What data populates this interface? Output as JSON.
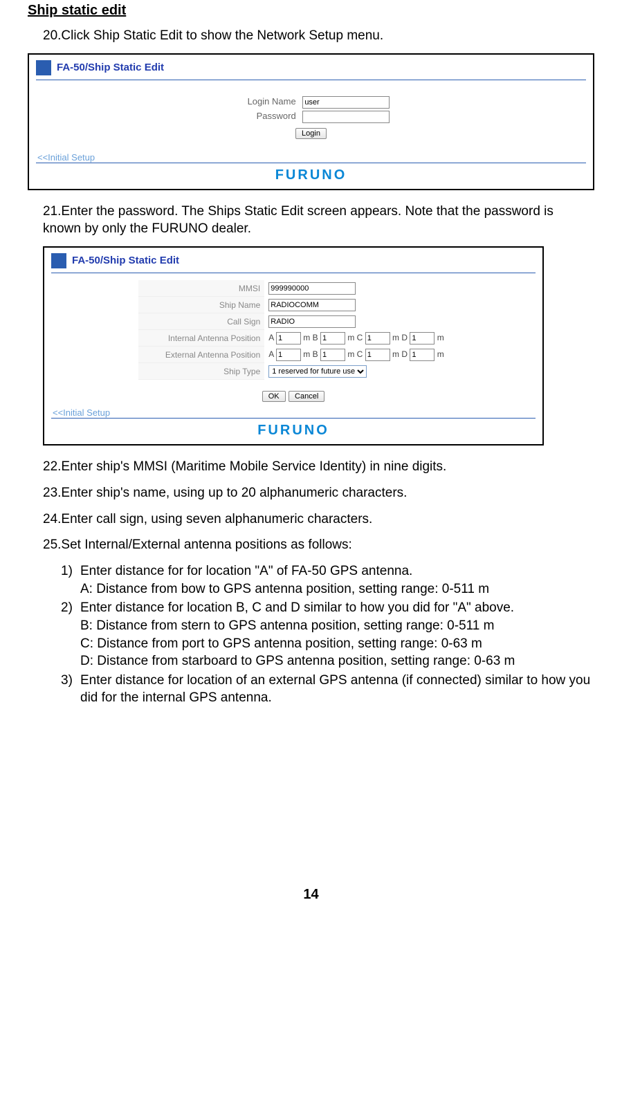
{
  "section_title": "Ship static edit",
  "step20": "20.Click Ship Static Edit to show the Network Setup menu.",
  "panel1": {
    "title": "FA-50/Ship Static Edit",
    "login_name_label": "Login Name",
    "login_name_value": "user",
    "password_label": "Password",
    "password_value": "",
    "login_btn": "Login",
    "back_link": "<<Initial Setup",
    "logo": "FURUNO"
  },
  "step21": "21.Enter the password. The Ships Static Edit screen appears. Note that the password is known by only the FURUNO dealer.",
  "panel2": {
    "title": "FA-50/Ship Static Edit",
    "fields": {
      "mmsi_label": "MMSI",
      "mmsi_value": "999990000",
      "shipname_label": "Ship Name",
      "shipname_value": "RADIOCOMM",
      "callsign_label": "Call Sign",
      "callsign_value": "RADIO",
      "intpos_label": "Internal Antenna Position",
      "extpos_label": "External Antenna Position",
      "shiptype_label": "Ship Type",
      "shiptype_value": "1 reserved for future use",
      "pos_a": "1",
      "pos_b": "1",
      "pos_c": "1",
      "pos_d": "1",
      "A": "A",
      "B": "B",
      "C": "C",
      "D": "D",
      "m": "m"
    },
    "ok_btn": "OK",
    "cancel_btn": "Cancel",
    "back_link": "<<Initial Setup",
    "logo": "FURUNO"
  },
  "step22": "22.Enter ship's MMSI (Maritime Mobile Service Identity) in nine digits.",
  "step23": "23.Enter ship's name, using up to 20 alphanumeric characters.",
  "step24": "24.Enter call sign, using seven alphanumeric characters.",
  "step25": "25.Set Internal/External antenna positions as follows:",
  "sub1_n": "1)",
  "sub1_t": "Enter distance for for location \"A\" of FA-50 GPS antenna.\nA: Distance from bow to GPS antenna position, setting range: 0-511 m",
  "sub2_n": "2)",
  "sub2_t": "Enter distance for location B, C and D similar to how you did for \"A\" above.\nB: Distance from stern to GPS antenna position, setting range: 0-511 m\nC: Distance from port to GPS antenna position, setting range: 0-63 m\nD: Distance from starboard to GPS antenna position, setting range: 0-63 m",
  "sub3_n": "3)",
  "sub3_t": "Enter distance for location of an external GPS antenna (if connected) similar to how you did for the internal GPS antenna.",
  "page_number": "14"
}
